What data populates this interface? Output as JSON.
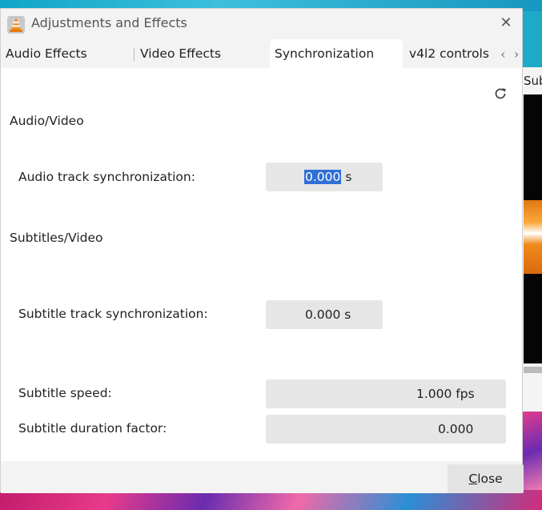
{
  "window": {
    "title": "Adjustments and Effects",
    "close_label": "Close",
    "close_mnemonic": "C",
    "close_rest": "lose"
  },
  "tabs": [
    {
      "label": "Audio Effects"
    },
    {
      "label": "Video Effects"
    },
    {
      "label": "Synchronization",
      "active": true
    },
    {
      "label": "v4l2 controls"
    }
  ],
  "sections": {
    "audio_video": "Audio/Video",
    "subtitles_video": "Subtitles/Video"
  },
  "fields": {
    "audio_sync": {
      "label": "Audio track synchronization:",
      "value": "0.000",
      "unit": "s"
    },
    "subtitle_sync": {
      "label": "Subtitle track synchronization:",
      "value": "0.000 s"
    },
    "subtitle_speed": {
      "label": "Subtitle speed:",
      "value": "1.000 fps"
    },
    "subtitle_duration": {
      "label": "Subtitle duration factor:",
      "value": "0.000"
    }
  },
  "behind": {
    "sub_text": "Sub"
  },
  "icons": {
    "refresh": "refresh-icon",
    "app": "vlc-cone-icon",
    "close": "close-icon"
  },
  "colors": {
    "selection": "#2f6fd6",
    "panel": "#ffffff",
    "window": "#f3f3f3"
  }
}
